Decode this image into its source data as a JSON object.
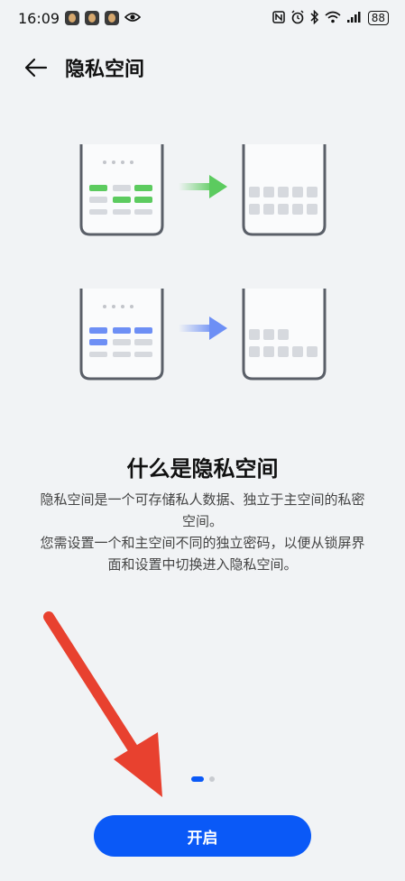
{
  "status_bar": {
    "time": "16:09",
    "battery": "88",
    "icons": [
      "nfc-icon",
      "alarm-icon",
      "bluetooth-icon",
      "wifi-icon",
      "signal-icon",
      "eye-icon"
    ]
  },
  "header": {
    "back_icon": "arrow-left-icon",
    "title": "隐私空间"
  },
  "illustration": {
    "green": "#5ccb5f",
    "blue": "#6d8ff5",
    "gray": "#d6d9de",
    "frame": "#5a5f68"
  },
  "intro": {
    "title": "什么是隐私空间",
    "lines": [
      "隐私空间是一个可存储私人数据、独立于主空间的私密",
      "空间。",
      "您需设置一个和主空间不同的独立密码，以便从锁屏界",
      "面和设置中切换进入隐私空间。"
    ]
  },
  "pager": {
    "current": 1,
    "total": 2
  },
  "button": {
    "label": "开启",
    "color": "#0a59f7"
  },
  "annotation": {
    "color": "#e8412f"
  }
}
